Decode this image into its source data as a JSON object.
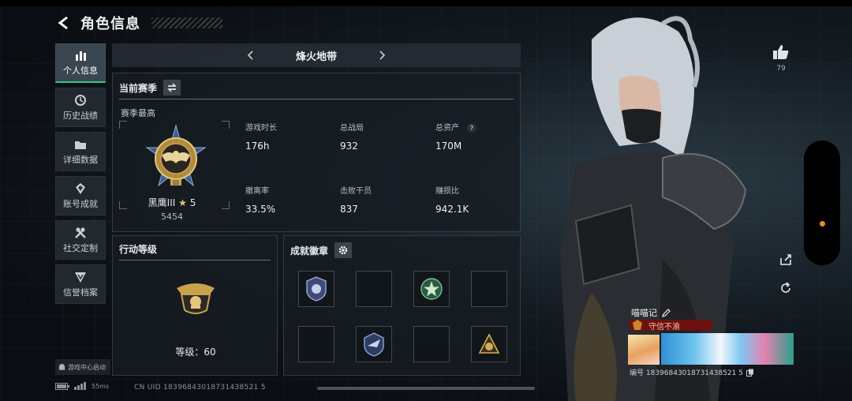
{
  "header": {
    "title": "角色信息"
  },
  "sidebar": {
    "items": [
      {
        "label": "个人信息",
        "icon": "bar-chart-icon",
        "active": true
      },
      {
        "label": "历史战绩",
        "icon": "history-icon",
        "active": false
      },
      {
        "label": "详细数据",
        "icon": "folder-icon",
        "active": false
      },
      {
        "label": "账号成就",
        "icon": "achievement-icon",
        "active": false
      },
      {
        "label": "社交定制",
        "icon": "tools-icon",
        "active": false
      },
      {
        "label": "信誉档案",
        "icon": "shield-icon",
        "active": false
      }
    ],
    "game_center": "游戏中心启动"
  },
  "season": {
    "name": "烽火地带"
  },
  "stats_panel": {
    "title": "当前赛季",
    "season_best": "赛季最高",
    "rank_name": "黑鹰III",
    "rank_stars": "5",
    "rank_score": "5454",
    "stats": [
      {
        "label": "游戏时长",
        "value": "176h"
      },
      {
        "label": "总战局",
        "value": "932"
      },
      {
        "label": "总资产",
        "value": "170M",
        "help": "?"
      },
      {
        "label": "撤离率",
        "value": "33.5%"
      },
      {
        "label": "击败干员",
        "value": "837"
      },
      {
        "label": "赚损比",
        "value": "942.1K"
      }
    ]
  },
  "level_panel": {
    "title": "行动等级",
    "level_text": "等级：60"
  },
  "badges_panel": {
    "title": "成就徽章",
    "slots": [
      {
        "icon": "police-badge-icon",
        "filled": true
      },
      {
        "icon": "",
        "filled": false
      },
      {
        "icon": "green-star-badge-icon",
        "filled": true
      },
      {
        "icon": "",
        "filled": false
      },
      {
        "icon": "",
        "filled": false
      },
      {
        "icon": "wing-shield-badge-icon",
        "filled": true
      },
      {
        "icon": "",
        "filled": false
      },
      {
        "icon": "gold-bag-badge-icon",
        "filled": true
      }
    ]
  },
  "status": {
    "network": "55ms",
    "uid": "CN UID 18396843018731438521 5"
  },
  "profile": {
    "likes": "79",
    "player_name": "喵喵记",
    "title_badge": "守信不渝",
    "player_id": "编号 18396843018731438521 5"
  },
  "colors": {
    "accent_green": "#2ecc8a",
    "orange": "#f08a24",
    "title_red": "#6e1010"
  }
}
